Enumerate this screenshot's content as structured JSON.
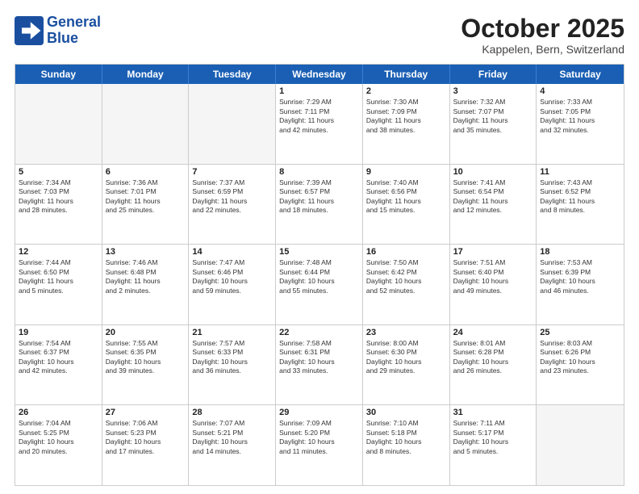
{
  "header": {
    "logo_line1": "General",
    "logo_line2": "Blue",
    "month": "October 2025",
    "location": "Kappelen, Bern, Switzerland"
  },
  "weekdays": [
    "Sunday",
    "Monday",
    "Tuesday",
    "Wednesday",
    "Thursday",
    "Friday",
    "Saturday"
  ],
  "rows": [
    [
      {
        "day": "",
        "lines": [],
        "empty": true
      },
      {
        "day": "",
        "lines": [],
        "empty": true
      },
      {
        "day": "",
        "lines": [],
        "empty": true
      },
      {
        "day": "1",
        "lines": [
          "Sunrise: 7:29 AM",
          "Sunset: 7:11 PM",
          "Daylight: 11 hours",
          "and 42 minutes."
        ]
      },
      {
        "day": "2",
        "lines": [
          "Sunrise: 7:30 AM",
          "Sunset: 7:09 PM",
          "Daylight: 11 hours",
          "and 38 minutes."
        ]
      },
      {
        "day": "3",
        "lines": [
          "Sunrise: 7:32 AM",
          "Sunset: 7:07 PM",
          "Daylight: 11 hours",
          "and 35 minutes."
        ]
      },
      {
        "day": "4",
        "lines": [
          "Sunrise: 7:33 AM",
          "Sunset: 7:05 PM",
          "Daylight: 11 hours",
          "and 32 minutes."
        ]
      }
    ],
    [
      {
        "day": "5",
        "lines": [
          "Sunrise: 7:34 AM",
          "Sunset: 7:03 PM",
          "Daylight: 11 hours",
          "and 28 minutes."
        ]
      },
      {
        "day": "6",
        "lines": [
          "Sunrise: 7:36 AM",
          "Sunset: 7:01 PM",
          "Daylight: 11 hours",
          "and 25 minutes."
        ]
      },
      {
        "day": "7",
        "lines": [
          "Sunrise: 7:37 AM",
          "Sunset: 6:59 PM",
          "Daylight: 11 hours",
          "and 22 minutes."
        ]
      },
      {
        "day": "8",
        "lines": [
          "Sunrise: 7:39 AM",
          "Sunset: 6:57 PM",
          "Daylight: 11 hours",
          "and 18 minutes."
        ]
      },
      {
        "day": "9",
        "lines": [
          "Sunrise: 7:40 AM",
          "Sunset: 6:56 PM",
          "Daylight: 11 hours",
          "and 15 minutes."
        ]
      },
      {
        "day": "10",
        "lines": [
          "Sunrise: 7:41 AM",
          "Sunset: 6:54 PM",
          "Daylight: 11 hours",
          "and 12 minutes."
        ]
      },
      {
        "day": "11",
        "lines": [
          "Sunrise: 7:43 AM",
          "Sunset: 6:52 PM",
          "Daylight: 11 hours",
          "and 8 minutes."
        ]
      }
    ],
    [
      {
        "day": "12",
        "lines": [
          "Sunrise: 7:44 AM",
          "Sunset: 6:50 PM",
          "Daylight: 11 hours",
          "and 5 minutes."
        ]
      },
      {
        "day": "13",
        "lines": [
          "Sunrise: 7:46 AM",
          "Sunset: 6:48 PM",
          "Daylight: 11 hours",
          "and 2 minutes."
        ]
      },
      {
        "day": "14",
        "lines": [
          "Sunrise: 7:47 AM",
          "Sunset: 6:46 PM",
          "Daylight: 10 hours",
          "and 59 minutes."
        ]
      },
      {
        "day": "15",
        "lines": [
          "Sunrise: 7:48 AM",
          "Sunset: 6:44 PM",
          "Daylight: 10 hours",
          "and 55 minutes."
        ]
      },
      {
        "day": "16",
        "lines": [
          "Sunrise: 7:50 AM",
          "Sunset: 6:42 PM",
          "Daylight: 10 hours",
          "and 52 minutes."
        ]
      },
      {
        "day": "17",
        "lines": [
          "Sunrise: 7:51 AM",
          "Sunset: 6:40 PM",
          "Daylight: 10 hours",
          "and 49 minutes."
        ]
      },
      {
        "day": "18",
        "lines": [
          "Sunrise: 7:53 AM",
          "Sunset: 6:39 PM",
          "Daylight: 10 hours",
          "and 46 minutes."
        ]
      }
    ],
    [
      {
        "day": "19",
        "lines": [
          "Sunrise: 7:54 AM",
          "Sunset: 6:37 PM",
          "Daylight: 10 hours",
          "and 42 minutes."
        ]
      },
      {
        "day": "20",
        "lines": [
          "Sunrise: 7:55 AM",
          "Sunset: 6:35 PM",
          "Daylight: 10 hours",
          "and 39 minutes."
        ]
      },
      {
        "day": "21",
        "lines": [
          "Sunrise: 7:57 AM",
          "Sunset: 6:33 PM",
          "Daylight: 10 hours",
          "and 36 minutes."
        ]
      },
      {
        "day": "22",
        "lines": [
          "Sunrise: 7:58 AM",
          "Sunset: 6:31 PM",
          "Daylight: 10 hours",
          "and 33 minutes."
        ]
      },
      {
        "day": "23",
        "lines": [
          "Sunrise: 8:00 AM",
          "Sunset: 6:30 PM",
          "Daylight: 10 hours",
          "and 29 minutes."
        ]
      },
      {
        "day": "24",
        "lines": [
          "Sunrise: 8:01 AM",
          "Sunset: 6:28 PM",
          "Daylight: 10 hours",
          "and 26 minutes."
        ]
      },
      {
        "day": "25",
        "lines": [
          "Sunrise: 8:03 AM",
          "Sunset: 6:26 PM",
          "Daylight: 10 hours",
          "and 23 minutes."
        ]
      }
    ],
    [
      {
        "day": "26",
        "lines": [
          "Sunrise: 7:04 AM",
          "Sunset: 5:25 PM",
          "Daylight: 10 hours",
          "and 20 minutes."
        ]
      },
      {
        "day": "27",
        "lines": [
          "Sunrise: 7:06 AM",
          "Sunset: 5:23 PM",
          "Daylight: 10 hours",
          "and 17 minutes."
        ]
      },
      {
        "day": "28",
        "lines": [
          "Sunrise: 7:07 AM",
          "Sunset: 5:21 PM",
          "Daylight: 10 hours",
          "and 14 minutes."
        ]
      },
      {
        "day": "29",
        "lines": [
          "Sunrise: 7:09 AM",
          "Sunset: 5:20 PM",
          "Daylight: 10 hours",
          "and 11 minutes."
        ]
      },
      {
        "day": "30",
        "lines": [
          "Sunrise: 7:10 AM",
          "Sunset: 5:18 PM",
          "Daylight: 10 hours",
          "and 8 minutes."
        ]
      },
      {
        "day": "31",
        "lines": [
          "Sunrise: 7:11 AM",
          "Sunset: 5:17 PM",
          "Daylight: 10 hours",
          "and 5 minutes."
        ]
      },
      {
        "day": "",
        "lines": [],
        "empty": true
      }
    ]
  ]
}
